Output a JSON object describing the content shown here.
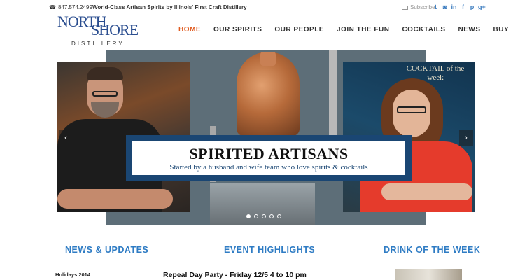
{
  "topbar": {
    "phone": "847.574.2499",
    "tagline": "World-Class Artisan Spirits by Illinois' First Craft Distillery",
    "subscribe": "Subscribe",
    "social": [
      "t",
      "in",
      "in",
      "f",
      "p",
      "g+"
    ]
  },
  "logo": {
    "north": "NORTH",
    "shore": "SHORE",
    "distillery": "DISTILLERY"
  },
  "nav": {
    "items": [
      {
        "label": "HOME",
        "active": true
      },
      {
        "label": "OUR SPIRITS",
        "active": false
      },
      {
        "label": "OUR PEOPLE",
        "active": false
      },
      {
        "label": "JOIN THE FUN",
        "active": false
      },
      {
        "label": "COCKTAILS",
        "active": false
      },
      {
        "label": "NEWS",
        "active": false
      },
      {
        "label": "BUY",
        "active": false
      }
    ]
  },
  "hero": {
    "title": "SPIRITED ARTISANS",
    "subtitle": "Started by a husband and wife team who love spirits & cocktails",
    "chalkboard": "COCKTAIL of the week",
    "slide_count": 5,
    "active_slide": 1
  },
  "sections": {
    "news": {
      "title": "NEWS & UPDATES",
      "first_item": "Holidays 2014"
    },
    "events": {
      "title": "EVENT HIGHLIGHTS",
      "first_item": "Repeal Day Party - Friday 12/5 4 to 10 pm"
    },
    "drink": {
      "title": "DRINK OF THE WEEK"
    }
  },
  "colors": {
    "accent_orange": "#e05a1e",
    "section_blue": "#2f7cc4",
    "banner_navy": "#1a4673",
    "logo_blue": "#2a4d8f"
  }
}
